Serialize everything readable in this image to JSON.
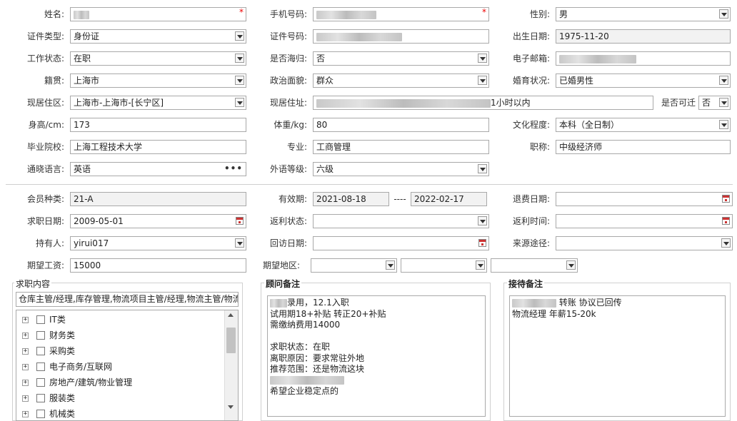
{
  "basic": {
    "name_label": "姓名:",
    "phone_label": "手机号码:",
    "gender_label": "性别:",
    "gender_value": "男",
    "idtype_label": "证件类型:",
    "idtype_value": "身份证",
    "idno_label": "证件号码:",
    "birth_label": "出生日期:",
    "birth_value": "1975-11-20",
    "workstatus_label": "工作状态:",
    "workstatus_value": "在职",
    "returnee_label": "是否海归:",
    "returnee_value": "否",
    "email_label": "电子邮箱:",
    "native_label": "籍贯:",
    "native_value": "上海市",
    "political_label": "政治面貌:",
    "political_value": "群众",
    "marital_label": "婚育状况:",
    "marital_value": "已婚男性",
    "residence_label": "现居住区:",
    "residence_value": "上海市-上海市-[长宁区]",
    "address_label": "现居住址:",
    "address_suffix": "1小时以内",
    "relocate_label": "是否可迁",
    "relocate_value": "否",
    "height_label": "身高/cm:",
    "height_value": "173",
    "weight_label": "体重/kg:",
    "weight_value": "80",
    "education_label": "文化程度:",
    "education_value": "本科（全日制）",
    "school_label": "毕业院校:",
    "school_value": "上海工程技术大学",
    "major_label": "专业:",
    "major_value": "工商管理",
    "title_label": "职称:",
    "title_value": "中级经济师",
    "language_label": "通晓语言:",
    "language_value": "英语",
    "foreign_level_label": "外语等级:",
    "foreign_level_value": "六级"
  },
  "membership": {
    "type_label": "会员种类:",
    "type_value": "21-A",
    "validity_label": "有效期:",
    "valid_from": "2021-08-18",
    "range_sep": "----",
    "valid_to": "2022-02-17",
    "refund_date_label": "退费日期:",
    "job_date_label": "求职日期:",
    "job_date_value": "2009-05-01",
    "rebate_status_label": "返利状态:",
    "rebate_time_label": "返利时间:",
    "holder_label": "持有人:",
    "holder_value": "yirui017",
    "revisit_label": "回访日期:",
    "source_label": "来源途径:",
    "salary_label": "期望工资:",
    "salary_value": "15000",
    "region_label": "期望地区:"
  },
  "job_content": {
    "title": "求职内容",
    "selected": "仓库主管/经理,库存管理,物流项目主管/经理,物流主管/物流",
    "tree": [
      {
        "label": "IT类"
      },
      {
        "label": "财务类"
      },
      {
        "label": "采购类"
      },
      {
        "label": "电子商务/互联网"
      },
      {
        "label": "房地产/建筑/物业管理"
      },
      {
        "label": "服装类"
      },
      {
        "label": "机械类"
      }
    ],
    "expand_glyph": "+"
  },
  "consultant_note": {
    "title": "顾问备注",
    "line1": "录用，12.1入职",
    "line2": "试用期18+补贴 转正20+补贴",
    "line3": "需缴纳费用14000",
    "line4": "",
    "line5": "求职状态：在职",
    "line6": "离职原因：要求常驻外地",
    "line7": "推荐范围：还是物流这块",
    "line8": "",
    "line9": "希望企业稳定点的"
  },
  "reception_note": {
    "title": "接待备注",
    "line1": "转账 协议已回传",
    "line2": "物流经理 年薪15-20k"
  },
  "icons": {
    "required_mark": "*",
    "more_dots": "•••"
  }
}
